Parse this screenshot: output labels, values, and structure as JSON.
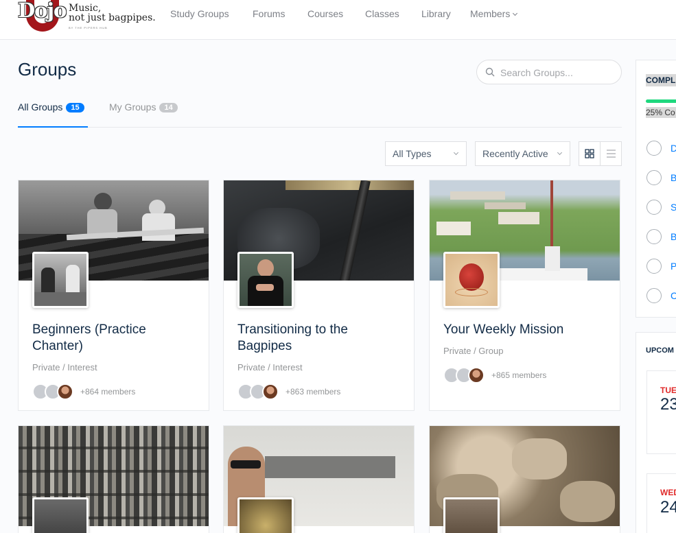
{
  "header": {
    "logo_word": "Dojo",
    "logo_line1": "Music,",
    "logo_line2": "not just bagpipes.",
    "logo_small": "BY THE PIPERS HUB",
    "nav": [
      "Study Groups",
      "Forums",
      "Courses",
      "Classes",
      "Library",
      "Members"
    ]
  },
  "page": {
    "title": "Groups",
    "search_placeholder": "Search Groups..."
  },
  "tabs": [
    {
      "label": "All Groups",
      "count": "15",
      "active": true
    },
    {
      "label": "My Groups",
      "count": "14",
      "active": false
    }
  ],
  "filters": {
    "type": "All Types",
    "order": "Recently Active"
  },
  "groups": [
    {
      "title": "Beginners (Practice Chanter)",
      "meta": "Private / Interest",
      "members": "+864 members"
    },
    {
      "title": "Transitioning to the Bagpipes",
      "meta": "Private / Interest",
      "members": "+863 members"
    },
    {
      "title": "Your Weekly Mission",
      "meta": "Private / Group",
      "members": "+865 members"
    },
    {
      "title": "",
      "meta": "",
      "members": ""
    },
    {
      "title": "",
      "meta": "",
      "members": ""
    },
    {
      "title": "",
      "meta": "",
      "members": ""
    }
  ],
  "sidebar": {
    "progress_heading": "COMPL",
    "progress_text": "25% Co",
    "progress_value": 0.25,
    "checklist": [
      "D",
      "B",
      "S",
      "B",
      "P",
      "C"
    ],
    "upcoming_heading": "UPCOM",
    "events": [
      {
        "day": "TUE",
        "date": "23"
      },
      {
        "day": "WED",
        "date": "24"
      }
    ]
  },
  "colors": {
    "accent": "#007cff",
    "title": "#122b46",
    "muted": "#939597",
    "progress": "#1fd87e",
    "event_day": "#e02a2a"
  }
}
